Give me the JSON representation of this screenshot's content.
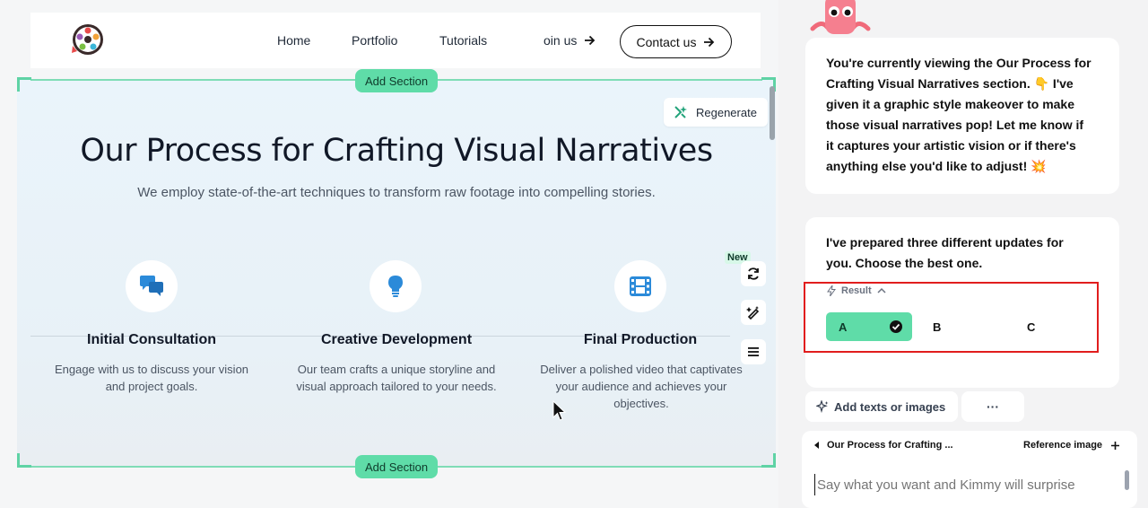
{
  "header": {
    "nav": [
      "Home",
      "Portfolio",
      "Tutorials",
      "oin us"
    ],
    "contact_label": "Contact us"
  },
  "editor": {
    "add_section_label": "Add Section",
    "regenerate_label": "Regenerate",
    "new_badge": "New"
  },
  "section": {
    "title": "Our Process for Crafting Visual Narratives",
    "subtitle": "We employ state-of-the-art techniques to transform raw footage into compelling stories.",
    "features": [
      {
        "title": "Initial Consultation",
        "desc_lines": [
          "Engage with us to discuss your vision",
          "and project goals."
        ],
        "icon": "chat-bubbles-icon"
      },
      {
        "title": "Creative Development",
        "desc_lines": [
          "Our team crafts a unique storyline and",
          "visual approach tailored to your needs."
        ],
        "icon": "lightbulb-icon"
      },
      {
        "title": "Final Production",
        "desc_lines": [
          "Deliver a polished video that captivates",
          "your audience and achieves your",
          "objectives."
        ],
        "icon": "film-icon"
      }
    ]
  },
  "chat": {
    "message1_lines": [
      "You're currently viewing the Our Process for",
      "Crafting Visual Narratives section. 👇 I've",
      "given it a graphic style makeover to make",
      "those visual narratives pop! Let me know if",
      "it captures your artistic vision or if there's",
      "anything else you'd like to adjust! 💥"
    ],
    "message2_lines": [
      "I've prepared three different updates for",
      "you. Choose the best one."
    ],
    "result_label": "Result",
    "options": [
      "A",
      "B",
      "C"
    ],
    "add_texts_label": "Add texts or images",
    "more_label": "···",
    "context_label": "Our Process for Crafting ...",
    "reference_label": "Reference image",
    "input_placeholder": "Say what you want and Kimmy will surprise"
  },
  "colors": {
    "accent_green": "#5fdca8",
    "highlight_red": "#e11d1d",
    "icon_blue": "#2b8ad9"
  }
}
